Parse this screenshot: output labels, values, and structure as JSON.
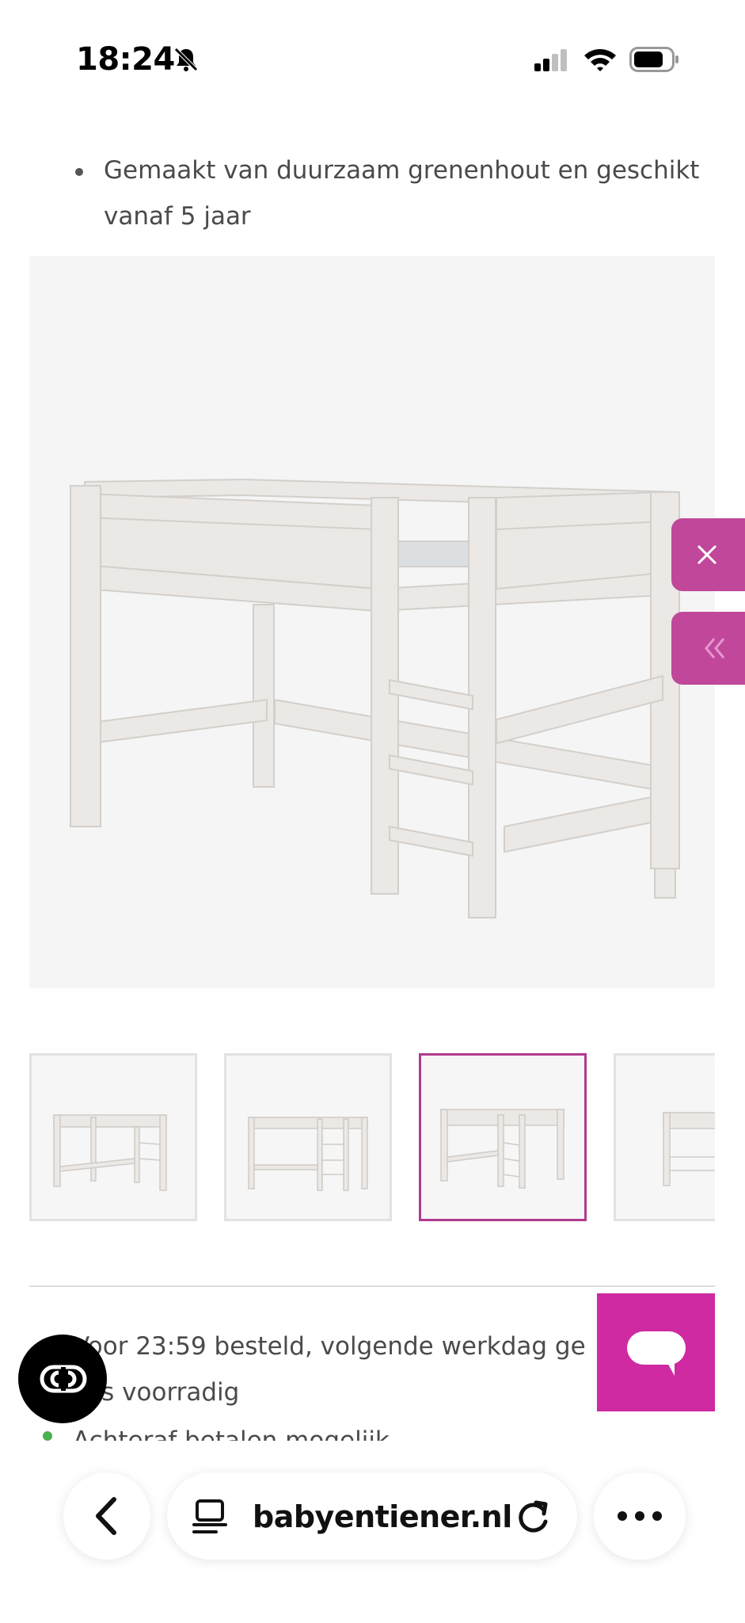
{
  "status_bar": {
    "time": "18:24",
    "icons": [
      "bell-slash-icon",
      "signal-icon",
      "wifi-icon",
      "battery-icon"
    ]
  },
  "product": {
    "bullet_text": "Gemaakt van duurzaam grenenhout en geschikt vanaf 5 jaar",
    "main_image_alt": "bed-image",
    "thumbnails": [
      {
        "name": "thumbnail-1",
        "active": false
      },
      {
        "name": "thumbnail-2",
        "active": false
      },
      {
        "name": "thumbnail-3",
        "active": true
      },
      {
        "name": "thumbnail-4",
        "active": false
      }
    ],
    "shipping_line_1": "Voor 23:59 besteld, volgende werkdag ge",
    "shipping_line_2": "ts voorradig",
    "shipping_line_3": "Achteraf betalen mogelijk"
  },
  "side_tabs": {
    "close_icon": "close-icon",
    "expand_icon": "double-chevron-left-icon"
  },
  "browser": {
    "url": "babyentiener.nl",
    "back_icon": "chevron-left-icon",
    "tabs_icon": "page-icon",
    "reload_icon": "reload-icon",
    "more_icon": "more-icon"
  },
  "colors": {
    "accent": "#c0479a",
    "chat": "#cf2aa1",
    "thumb_active_border": "#b03a8e"
  }
}
